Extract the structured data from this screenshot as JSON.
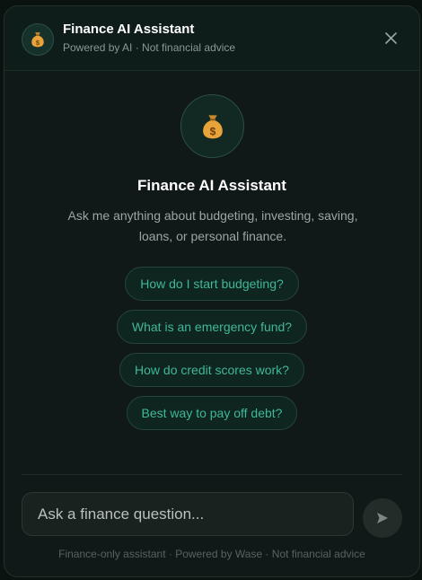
{
  "header": {
    "title": "Finance AI Assistant",
    "subtitle": "Powered by AI · Not financial advice",
    "avatar_icon": "money-bag-icon",
    "close_icon": "close-icon"
  },
  "hero": {
    "icon": "money-bag-icon",
    "title": "Finance AI Assistant",
    "description": "Ask me anything about budgeting, investing, saving, loans, or personal finance."
  },
  "suggestions": [
    {
      "label": "How do I start budgeting?"
    },
    {
      "label": "What is an emergency fund?"
    },
    {
      "label": "How do credit scores work?"
    },
    {
      "label": "Best way to pay off debt?"
    }
  ],
  "composer": {
    "placeholder": "Ask a finance question...",
    "value": "",
    "send_icon": "send-icon"
  },
  "footer": {
    "text": "Finance-only assistant · Powered by Wase · Not financial advice"
  },
  "colors": {
    "accent": "#3fb89a",
    "background": "#111918",
    "header_background": "#0f1d1a",
    "chip_background": "#0f2520"
  }
}
